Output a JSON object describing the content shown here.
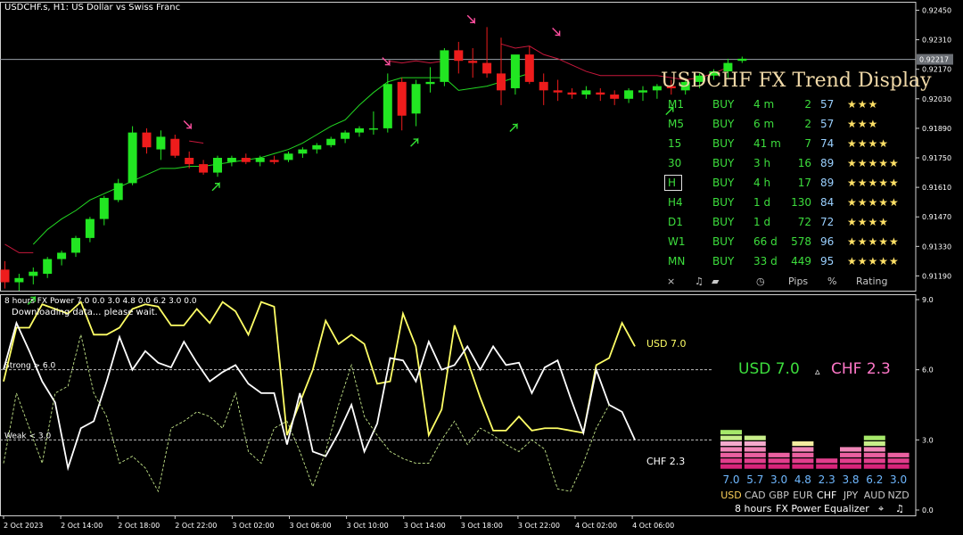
{
  "header": {
    "title": "USDCHF.s, H1:  US Dollar vs Swiss Franc"
  },
  "colors": {
    "bull": "#22e622",
    "bear": "#ee1c1c",
    "usd": "#ffff66",
    "chf": "#ffffff",
    "green_text": "#3dde3d",
    "pink_text": "#ff77c8",
    "star": "#ffe066"
  },
  "chart_data": [
    {
      "type": "candlestick",
      "y_ticks": [
        "0.92450",
        "0.92310",
        "0.92170",
        "0.92030",
        "0.91890",
        "0.91750",
        "0.91610",
        "0.91470",
        "0.91330",
        "0.91190"
      ],
      "current_price": "0.92217",
      "ylim": [
        0.9112,
        0.9249
      ],
      "candles": [
        [
          0.9122,
          0.9126,
          0.9113,
          0.9116
        ],
        [
          0.9116,
          0.912,
          0.9112,
          0.9118
        ],
        [
          0.9119,
          0.9123,
          0.9115,
          0.9121
        ],
        [
          0.912,
          0.9128,
          0.9118,
          0.9127
        ],
        [
          0.9127,
          0.9131,
          0.9124,
          0.913
        ],
        [
          0.913,
          0.9138,
          0.9128,
          0.9137
        ],
        [
          0.9137,
          0.9147,
          0.9135,
          0.9146
        ],
        [
          0.9146,
          0.9157,
          0.9143,
          0.9156
        ],
        [
          0.9155,
          0.9165,
          0.9154,
          0.9163
        ],
        [
          0.9163,
          0.919,
          0.9162,
          0.9187
        ],
        [
          0.9187,
          0.9189,
          0.9177,
          0.918
        ],
        [
          0.9179,
          0.9188,
          0.9174,
          0.9185
        ],
        [
          0.9184,
          0.9186,
          0.9175,
          0.9176
        ],
        [
          0.9175,
          0.9178,
          0.917,
          0.9172
        ],
        [
          0.9172,
          0.9174,
          0.9167,
          0.9168
        ],
        [
          0.9168,
          0.9176,
          0.9166,
          0.9175
        ],
        [
          0.9173,
          0.9176,
          0.9171,
          0.9175
        ],
        [
          0.9175,
          0.9177,
          0.9172,
          0.9173
        ],
        [
          0.9173,
          0.9176,
          0.9171,
          0.9175
        ],
        [
          0.9174,
          0.9176,
          0.9172,
          0.9173
        ],
        [
          0.9174,
          0.9178,
          0.9173,
          0.9177
        ],
        [
          0.9177,
          0.918,
          0.9175,
          0.9179
        ],
        [
          0.9179,
          0.9182,
          0.9177,
          0.9181
        ],
        [
          0.9181,
          0.9185,
          0.918,
          0.9184
        ],
        [
          0.9184,
          0.9188,
          0.9182,
          0.9187
        ],
        [
          0.9187,
          0.919,
          0.9185,
          0.9189
        ],
        [
          0.9189,
          0.9197,
          0.9186,
          0.9189
        ],
        [
          0.9189,
          0.9215,
          0.9187,
          0.921
        ],
        [
          0.9211,
          0.9213,
          0.9188,
          0.9195
        ],
        [
          0.9196,
          0.9212,
          0.919,
          0.921
        ],
        [
          0.921,
          0.9218,
          0.9206,
          0.9211
        ],
        [
          0.9211,
          0.9227,
          0.9209,
          0.9226
        ],
        [
          0.9226,
          0.923,
          0.9215,
          0.9221
        ],
        [
          0.9221,
          0.9227,
          0.9213,
          0.922
        ],
        [
          0.922,
          0.9237,
          0.9213,
          0.9215
        ],
        [
          0.9215,
          0.9232,
          0.92,
          0.9207
        ],
        [
          0.9208,
          0.9223,
          0.9205,
          0.9224
        ],
        [
          0.9224,
          0.9228,
          0.921,
          0.9211
        ],
        [
          0.9211,
          0.9215,
          0.92,
          0.9207
        ],
        [
          0.9207,
          0.9212,
          0.9202,
          0.9206
        ],
        [
          0.9206,
          0.9208,
          0.9203,
          0.9205
        ],
        [
          0.9205,
          0.9209,
          0.9203,
          0.9207
        ],
        [
          0.9206,
          0.9208,
          0.9202,
          0.9205
        ],
        [
          0.9205,
          0.9207,
          0.92,
          0.9203
        ],
        [
          0.9203,
          0.9208,
          0.9201,
          0.9207
        ],
        [
          0.9206,
          0.9209,
          0.9202,
          0.9207
        ],
        [
          0.9207,
          0.921,
          0.9203,
          0.9209
        ],
        [
          0.9209,
          0.9212,
          0.9205,
          0.9208
        ],
        [
          0.9207,
          0.9212,
          0.9205,
          0.9211
        ],
        [
          0.9211,
          0.9215,
          0.9208,
          0.9214
        ],
        [
          0.9214,
          0.9217,
          0.9212,
          0.9216
        ],
        [
          0.9216,
          0.9222,
          0.9213,
          0.922
        ],
        [
          0.9221,
          0.9223,
          0.922,
          0.9222
        ]
      ],
      "signal_line": [
        0.9134,
        0.9141,
        0.9146,
        0.915,
        0.9155,
        0.9158,
        0.9161,
        0.9164,
        0.9167,
        0.917,
        0.917,
        0.9171,
        0.9171,
        0.9172,
        0.9173,
        0.9174,
        0.9175,
        0.9177,
        0.9179,
        0.9182,
        0.9186,
        0.919,
        0.9193,
        0.92,
        0.9206,
        0.9211,
        0.9213,
        0.9213,
        0.9213,
        0.9213,
        0.9207,
        0.9208,
        0.9209,
        0.9211,
        0.9213,
        0.9215
      ],
      "pink_line": [
        0.9134,
        0.913,
        0.913,
        null,
        null,
        null,
        null,
        null,
        null,
        null,
        null,
        null,
        null,
        0.9183,
        0.9182,
        null,
        null,
        null,
        null,
        null,
        null,
        null,
        null,
        null,
        null,
        null,
        null,
        0.9221,
        0.922,
        0.9221,
        0.922,
        0.9221,
        null,
        null,
        null,
        0.9229,
        0.9227,
        0.9228,
        0.9224,
        0.9222,
        0.9219,
        0.9216,
        0.9214,
        0.9214,
        0.9214,
        0.9214,
        0.9214,
        0.9213,
        0.9212,
        0.9213,
        0.9215,
        0.9218
      ],
      "down_arrows": [
        [
          13,
          0.919
        ],
        [
          27,
          0.922
        ],
        [
          33,
          0.924
        ],
        [
          39,
          0.9234
        ]
      ],
      "up_arrows": [
        [
          2,
          0.9108
        ],
        [
          15,
          0.9162
        ],
        [
          29,
          0.9183
        ],
        [
          36,
          0.919
        ],
        [
          47,
          0.9198
        ]
      ]
    },
    {
      "type": "line",
      "title": "8 hours FX Power 7.0 0.0 3.0 4.8 0.0 6.2 3.0 0.0",
      "status": "Downloading data... please wait.",
      "ylim": [
        0,
        9
      ],
      "y_ticks": [
        "9.0",
        "6.0",
        "3.0",
        "0.0"
      ],
      "strong_label": "Strong > 6.0",
      "weak_label": "Weak < 3.0",
      "x_labels": [
        "2 Oct 2023",
        "2 Oct 14:00",
        "2 Oct 18:00",
        "2 Oct 22:00",
        "3 Oct 02:00",
        "3 Oct 06:00",
        "3 Oct 10:00",
        "3 Oct 14:00",
        "3 Oct 18:00",
        "3 Oct 22:00",
        "4 Oct 02:00",
        "4 Oct 06:00"
      ],
      "series": [
        {
          "name": "USD 7.0",
          "values": [
            5.5,
            7.8,
            7.8,
            8.8,
            8.6,
            8.4,
            8.9,
            7.5,
            7.5,
            7.8,
            8.6,
            8.8,
            8.7,
            7.9,
            7.9,
            8.6,
            8.0,
            8.9,
            8.5,
            7.5,
            8.9,
            8.7,
            3.2,
            4.6,
            6.0,
            8.1,
            7.1,
            7.5,
            7.1,
            5.4,
            5.5,
            8.4,
            7.0,
            3.2,
            4.3,
            7.9,
            6.4,
            4.8,
            3.4,
            3.4,
            4.0,
            3.4,
            3.5,
            3.5,
            3.4,
            3.3,
            6.2,
            6.5,
            8.0,
            7.0
          ]
        },
        {
          "name": "CHF 2.3",
          "values": [
            6.0,
            8.0,
            6.8,
            5.5,
            4.6,
            1.8,
            3.5,
            3.8,
            5.5,
            7.4,
            6.0,
            6.8,
            6.3,
            6.1,
            7.2,
            6.3,
            5.5,
            5.9,
            6.2,
            5.4,
            5.0,
            5.0,
            2.8,
            5.0,
            2.5,
            2.3,
            3.3,
            4.5,
            2.5,
            3.7,
            6.5,
            6.4,
            5.5,
            7.2,
            6.0,
            6.2,
            7.0,
            6.0,
            7.0,
            6.2,
            6.3,
            5.0,
            6.1,
            6.4,
            4.8,
            3.3,
            6.0,
            4.5,
            4.2,
            3.0
          ]
        },
        {
          "name": "",
          "values": [
            2.0,
            5.0,
            3.5,
            2.0,
            5.0,
            5.3,
            7.5,
            5.0,
            4.0,
            2.0,
            2.3,
            1.8,
            0.8,
            3.5,
            3.8,
            4.2,
            4.0,
            3.5,
            5.0,
            2.5,
            2.0,
            3.5,
            3.8,
            2.5,
            1.0,
            2.5,
            4.5,
            6.2,
            4.0,
            3.2,
            2.5,
            2.2,
            2.0,
            2.0,
            3.0,
            3.8,
            2.8,
            3.5,
            3.2,
            2.8,
            2.5,
            3.0,
            2.6,
            0.9,
            0.8,
            2.0,
            3.5,
            4.5
          ]
        }
      ]
    },
    {
      "type": "bar",
      "title": "USD 7.0",
      "subtitle": "CHF 2.3",
      "delta": "▵",
      "categories": [
        "USD",
        "CAD",
        "GBP",
        "EUR",
        "CHF",
        "JPY",
        "AUD",
        "NZD"
      ],
      "value_labels": [
        "7.0",
        "5.7",
        "3.0",
        "4.8",
        "2.3",
        "3.8",
        "6.2",
        "3.0"
      ],
      "values": [
        7.0,
        5.7,
        3.0,
        4.8,
        2.3,
        3.8,
        6.2,
        3.0
      ],
      "ylim": [
        0,
        9
      ],
      "legend": [
        "8 hours",
        "FX Power",
        "Equalizer"
      ]
    }
  ],
  "trend": {
    "title": "USDCHF FX Trend Display",
    "rows": [
      {
        "tf": "M1",
        "dir": "BUY",
        "time": "4 m",
        "pips": "2",
        "pct": "57",
        "stars": "★★★"
      },
      {
        "tf": "M5",
        "dir": "BUY",
        "time": "6 m",
        "pips": "2",
        "pct": "57",
        "stars": "★★★"
      },
      {
        "tf": "15",
        "dir": "BUY",
        "time": "41 m",
        "pips": "7",
        "pct": "74",
        "stars": "★★★★"
      },
      {
        "tf": "30",
        "dir": "BUY",
        "time": "3 h",
        "pips": "16",
        "pct": "89",
        "stars": "★★★★★"
      },
      {
        "tf": "H",
        "dir": "BUY",
        "time": "4 h",
        "pips": "17",
        "pct": "89",
        "stars": "★★★★★"
      },
      {
        "tf": "H4",
        "dir": "BUY",
        "time": "1 d",
        "pips": "130",
        "pct": "84",
        "stars": "★★★★★"
      },
      {
        "tf": "D1",
        "dir": "BUY",
        "time": "1 d",
        "pips": "72",
        "pct": "72",
        "stars": "★★★★"
      },
      {
        "tf": "W1",
        "dir": "BUY",
        "time": "66 d",
        "pips": "578",
        "pct": "96",
        "stars": "★★★★★"
      },
      {
        "tf": "MN",
        "dir": "BUY",
        "time": "33 d",
        "pips": "449",
        "pct": "95",
        "stars": "★★★★★"
      }
    ],
    "footer": {
      "close": "×",
      "sound": "♫",
      "clock": "◷",
      "pips": "Pips",
      "pct": "%",
      "rating": "Rating"
    }
  }
}
